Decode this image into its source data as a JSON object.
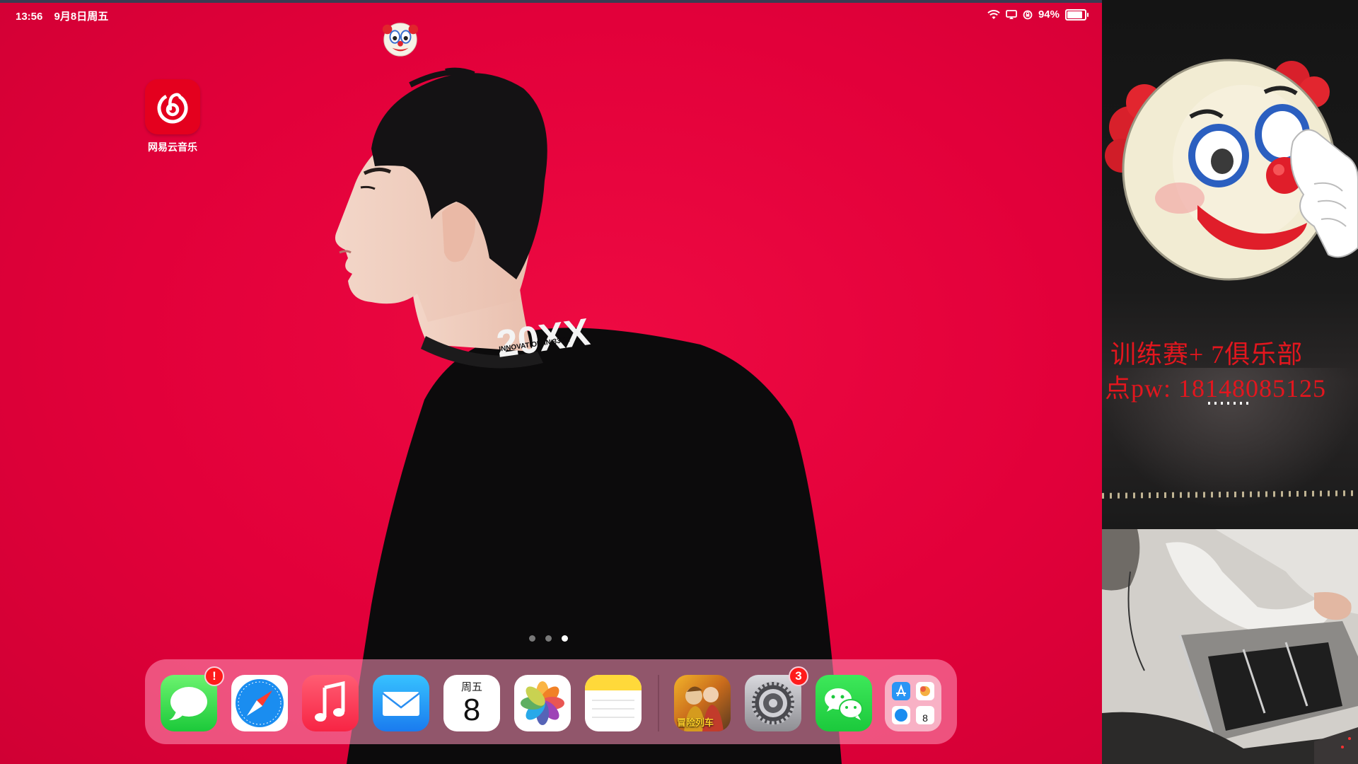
{
  "statusbar": {
    "time": "13:56",
    "date": "9月8日周五",
    "battery": "94%",
    "battery_level": 0.94,
    "icons": [
      "wifi-icon",
      "screen-mirror-icon",
      "orientation-lock-icon",
      "battery-icon"
    ]
  },
  "home": {
    "apps": [
      {
        "label": "网易云音乐",
        "icon": "netease-cloud-music-icon"
      }
    ],
    "page_count": 3,
    "active_page": 3
  },
  "wallpaper": {
    "shirt_graphic_main": "20XX",
    "shirt_graphic_sub": "INNOVATION IN 33TH"
  },
  "dock": {
    "apps": [
      {
        "name": "Messages",
        "icon": "messages-icon",
        "badge": "!"
      },
      {
        "name": "Safari",
        "icon": "safari-icon",
        "badge": ""
      },
      {
        "name": "Music",
        "icon": "music-icon",
        "badge": ""
      },
      {
        "name": "Mail",
        "icon": "mail-icon",
        "badge": ""
      },
      {
        "name": "Calendar",
        "icon": "calendar-icon",
        "badge": "",
        "weekday": "周五",
        "day": "8"
      },
      {
        "name": "Photos",
        "icon": "photos-icon",
        "badge": ""
      },
      {
        "name": "Notes",
        "icon": "notes-icon",
        "badge": ""
      },
      {
        "name": "Game",
        "icon": "game-icon",
        "badge": "",
        "caption": "冒险列车"
      },
      {
        "name": "Settings",
        "icon": "settings-icon",
        "badge": "3"
      },
      {
        "name": "WeChat",
        "icon": "wechat-icon",
        "badge": ""
      },
      {
        "name": "App Library",
        "icon": "app-library-icon",
        "badge": "",
        "mini_day": "8"
      }
    ]
  },
  "stream_overlay": {
    "line1": "训练赛+    7俱乐部",
    "line2": "点pw:  18148085125"
  },
  "colors": {
    "wallpaper_red": "#e2003a",
    "overlay_red": "#e2161e",
    "badge_red": "#ff1b1b"
  }
}
